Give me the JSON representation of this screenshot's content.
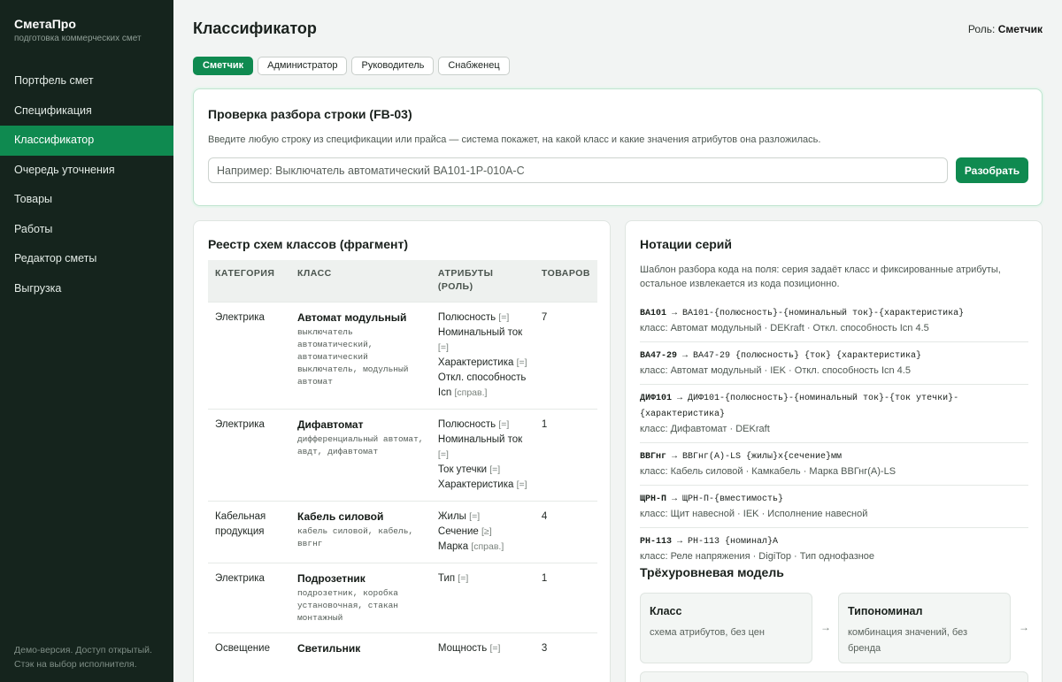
{
  "app": {
    "name": "СметаПро",
    "tagline": "подготовка коммерческих смет"
  },
  "sidebar": {
    "items": [
      {
        "label": "Портфель смет",
        "active": false
      },
      {
        "label": "Спецификация",
        "active": false
      },
      {
        "label": "Классификатор",
        "active": true
      },
      {
        "label": "Очередь уточнения",
        "active": false
      },
      {
        "label": "Товары",
        "active": false
      },
      {
        "label": "Работы",
        "active": false
      },
      {
        "label": "Редактор сметы",
        "active": false
      },
      {
        "label": "Выгрузка",
        "active": false
      }
    ],
    "footer_line1": "Демо-версия. Доступ открытый.",
    "footer_line2": "Стэк на выбор исполнителя."
  },
  "header": {
    "title": "Классификатор",
    "role_label": "Роль:",
    "role_value": "Сметчик"
  },
  "role_tabs": [
    {
      "label": "Сметчик",
      "active": true
    },
    {
      "label": "Администратор",
      "active": false
    },
    {
      "label": "Руководитель",
      "active": false
    },
    {
      "label": "Снабженец",
      "active": false
    }
  ],
  "parse_check": {
    "title": "Проверка разбора строки (FB-03)",
    "description": "Введите любую строку из спецификации или прайса — система покажет, на какой класс и какие значения атрибутов она разложилась.",
    "input_value": "",
    "input_placeholder": "Например: Выключатель автоматический ВА101-1Р-010А-С",
    "button_label": "Разобрать"
  },
  "registry": {
    "title": "Реестр схем классов (фрагмент)",
    "columns": [
      "КАТЕГОРИЯ",
      "КЛАСС",
      "АТРИБУТЫ (РОЛЬ)",
      "ТОВАРОВ"
    ],
    "rows": [
      {
        "category": "Электрика",
        "class_name": "Автомат модульный",
        "synonyms": "выключатель автоматический, автоматический выключатель, модульный автомат",
        "attributes": [
          {
            "name": "Полюсность",
            "role": "[=]"
          },
          {
            "name": "Номинальный ток",
            "role": "[=]"
          },
          {
            "name": "Характеристика",
            "role": "[=]"
          },
          {
            "name": "Откл. способность Icn",
            "role": "[справ.]"
          }
        ],
        "count": "7"
      },
      {
        "category": "Электрика",
        "class_name": "Дифавтомат",
        "synonyms": "дифференциальный автомат, авдт, дифавтомат",
        "attributes": [
          {
            "name": "Полюсность",
            "role": "[=]"
          },
          {
            "name": "Номинальный ток",
            "role": "[=]"
          },
          {
            "name": "Ток утечки",
            "role": "[=]"
          },
          {
            "name": "Характеристика",
            "role": "[=]"
          }
        ],
        "count": "1"
      },
      {
        "category": "Кабельная продукция",
        "class_name": "Кабель силовой",
        "synonyms": "кабель силовой, кабель, ввгнг",
        "attributes": [
          {
            "name": "Жилы",
            "role": "[=]"
          },
          {
            "name": "Сечение",
            "role": "[≥]"
          },
          {
            "name": "Марка",
            "role": "[справ.]"
          }
        ],
        "count": "4"
      },
      {
        "category": "Электрика",
        "class_name": "Подрозетник",
        "synonyms": "подрозетник, коробка установочная, стакан монтажный",
        "attributes": [
          {
            "name": "Тип",
            "role": "[=]"
          }
        ],
        "count": "1"
      },
      {
        "category": "Освещение",
        "class_name": "Светильник",
        "synonyms": "",
        "attributes": [
          {
            "name": "Мощность",
            "role": "[=]"
          }
        ],
        "count": "3"
      }
    ]
  },
  "notations": {
    "title": "Нотации серий",
    "description": "Шаблон разбора кода на поля: серия задаёт класс и фиксированные атрибуты, остальное извлекается из кода позиционно.",
    "series": [
      {
        "code": "ВА101",
        "pattern": " → ВА101-{полюсность}-{номинальный ток}-{характеристика}",
        "class_line": "класс: Автомат модульный · DEKraft · Откл. способность Icn 4.5"
      },
      {
        "code": "ВА47-29",
        "pattern": " → ВА47-29 {полюсность} {ток} {характеристика}",
        "class_line": "класс: Автомат модульный · IEK · Откл. способность Icn 4.5"
      },
      {
        "code": "ДИФ101",
        "pattern": " → ДИФ101-{полюсность}-{номинальный ток}-{ток утечки}-{характеристика}",
        "class_line": "класс: Дифавтомат · DEKraft"
      },
      {
        "code": "ВВГнг",
        "pattern": " → ВВГнг(А)-LS {жилы}x{сечение}мм",
        "class_line": "класс: Кабель силовой · Камкабель · Марка ВВГнг(А)-LS"
      },
      {
        "code": "ЩРН-П",
        "pattern": " → ЩРН-П-{вместимость}",
        "class_line": "класс: Щит навесной · IEK · Исполнение навесной"
      },
      {
        "code": "РН-113",
        "pattern": " → РН-113 {номинал}А",
        "class_line": "класс: Реле напряжения · DigiTop · Тип однофазное"
      }
    ],
    "model_title": "Трёхуровневая модель",
    "model": [
      {
        "title": "Класс",
        "desc": "схема атрибутов, без цен"
      },
      {
        "title": "Типономинал",
        "desc": "комбинация значений, без бренда"
      }
    ],
    "arrow": "→"
  }
}
